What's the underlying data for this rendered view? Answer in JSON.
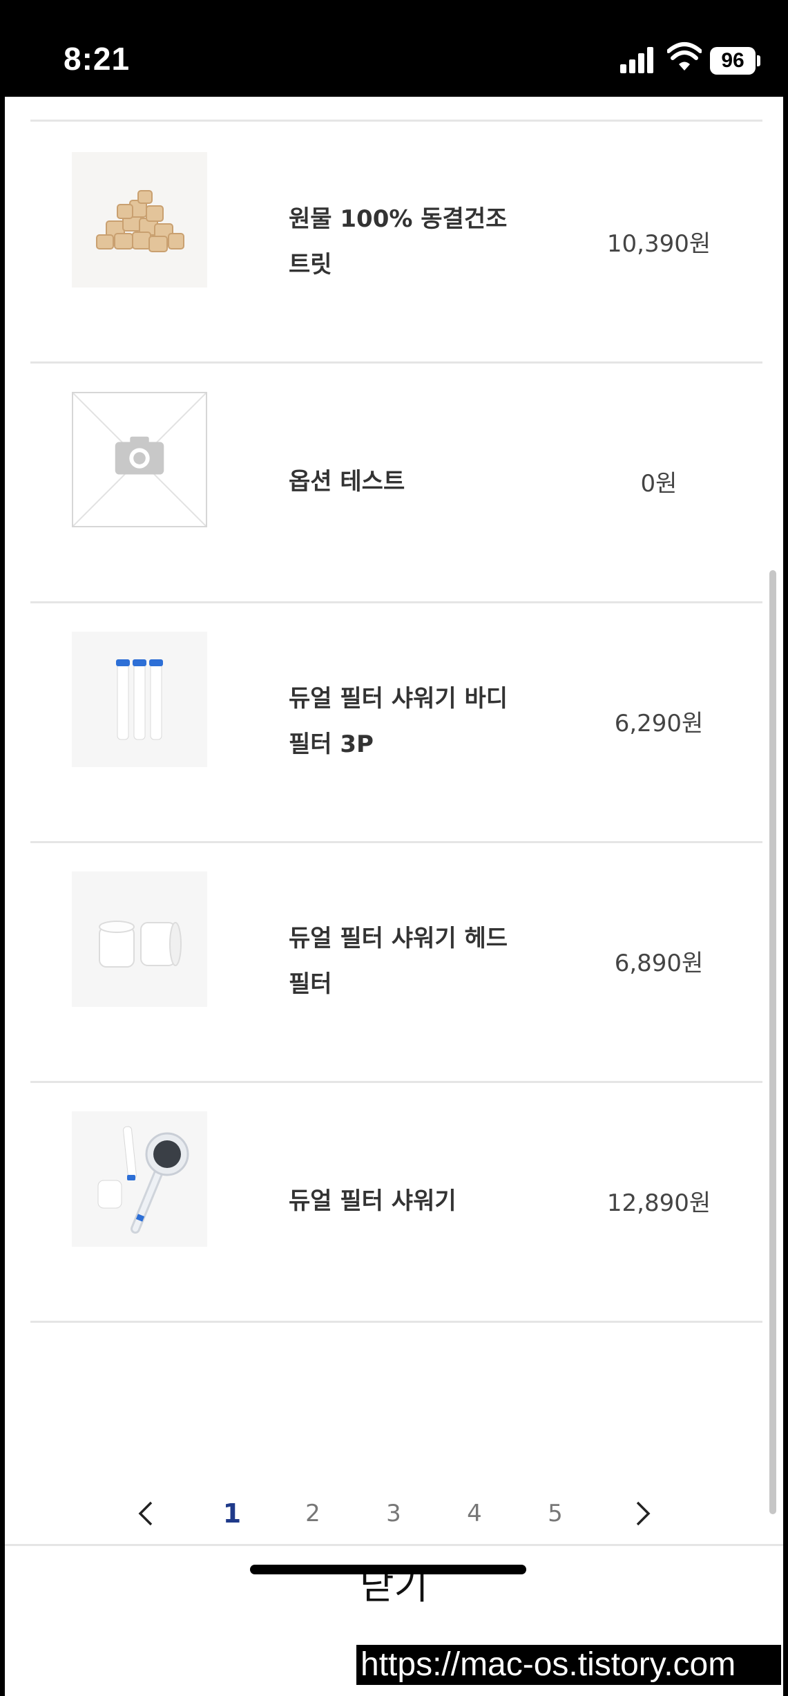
{
  "status_bar": {
    "time": "8:21",
    "battery": "96"
  },
  "products": [
    {
      "name": "원물 100% 동결건조 트릿",
      "price": "10,390원",
      "image": "freeze-dried-treat-photo"
    },
    {
      "name": "옵션 테스트",
      "price": "0원",
      "image": "camera-placeholder-icon"
    },
    {
      "name": "듀얼 필터 샤워기 바디필터 3P",
      "price": "6,290원",
      "image": "body-filter-3p-photo"
    },
    {
      "name": "듀얼 필터 샤워기 헤드필터",
      "price": "6,890원",
      "image": "head-filter-photo"
    },
    {
      "name": "듀얼 필터 샤워기",
      "price": "12,890원",
      "image": "shower-head-photo"
    }
  ],
  "pagination": {
    "pages": [
      "1",
      "2",
      "3",
      "4",
      "5"
    ],
    "current": "1"
  },
  "close_label": "닫기",
  "watermark": "https://mac-os.tistory.com",
  "colors": {
    "active_page": "#1f3a8a",
    "divider": "#e5e5e5"
  }
}
